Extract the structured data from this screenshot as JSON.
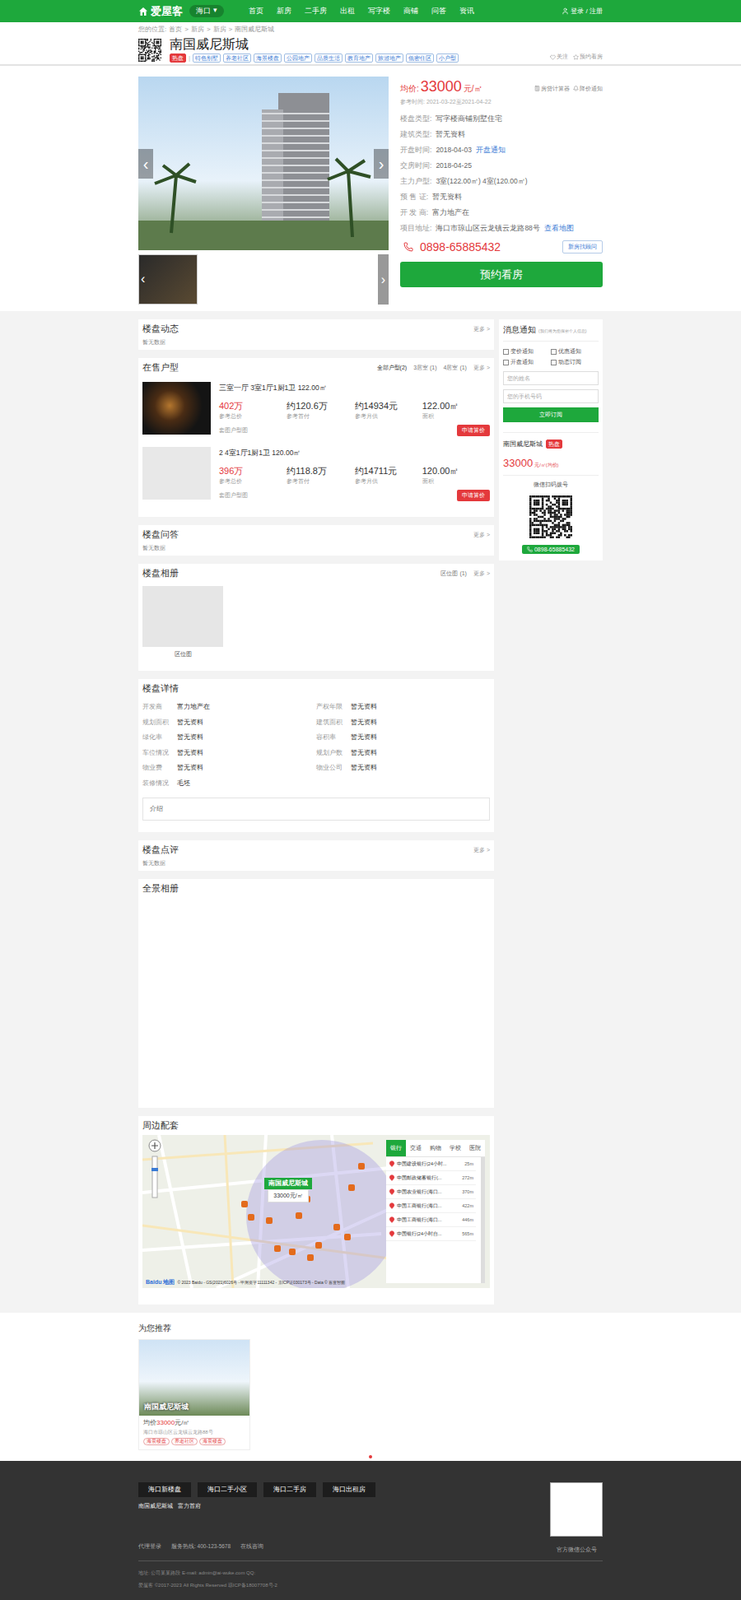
{
  "header": {
    "logo": "爱屋客",
    "city": "海口",
    "city_arrow": "▾",
    "nav": [
      "首页",
      "新房",
      "二手房",
      "出租",
      "写字楼",
      "商铺",
      "问答",
      "资讯"
    ],
    "login": "登录 / 注册"
  },
  "breadcrumb": {
    "label": "您的位置:",
    "separator": ">",
    "items": [
      "首页",
      "新房",
      "新房",
      "南国威尼斯城"
    ]
  },
  "project": {
    "name": "南国威尼斯城",
    "hot": "热盘",
    "divider": "|",
    "tags": [
      "特色别墅",
      "养老社区",
      "海景楼盘",
      "公园地产",
      "品质生活",
      "教育地产",
      "旅游地产",
      "低密住区",
      "小户型"
    ],
    "follow": "关注",
    "book": "预约看房"
  },
  "gallery": {
    "prev": "‹",
    "next": "›",
    "thumb_prev": "‹",
    "thumb_next": "›"
  },
  "info": {
    "price_label": "均价:",
    "price": "33000",
    "price_unit": "元/㎡",
    "calc": "房贷计算器",
    "notify": "降价通知",
    "ref_time_label": "参考时间:",
    "ref_time": "2021-03-22至2021-04-22",
    "rows": [
      {
        "label": "楼盘类型:",
        "value": "写字楼商铺别墅住宅"
      },
      {
        "label": "建筑类型:",
        "value": "暂无资料"
      },
      {
        "label": "开盘时间:",
        "value": "2018-04-03",
        "link": "开盘通知"
      },
      {
        "label": "交房时间:",
        "value": "2018-04-25"
      },
      {
        "label": "主力户型:",
        "value": "3室(122.00㎡) 4室(120.00㎡)"
      },
      {
        "label": "预 售 证:",
        "value": "暂无资料"
      },
      {
        "label": "开 发 商:",
        "value": "富力地产在"
      },
      {
        "label": "项目地址:",
        "value": "海口市琼山区云龙镇云龙路88号",
        "link": "查看地图"
      }
    ],
    "phone": "0898-65885432",
    "consultant": "新房找顾问",
    "cta": "预约看房"
  },
  "more": "更多 >",
  "empty": "暂无数据",
  "dynamics": {
    "title": "楼盘动态"
  },
  "units": {
    "title": "在售户型",
    "tabs": [
      {
        "label": "全部户型(2)",
        "selected": true
      },
      {
        "label": "3居室 (1)",
        "selected": false
      },
      {
        "label": "4居室 (1)",
        "selected": false
      }
    ],
    "stat_labels": [
      "参考总价",
      "参考首付",
      "参考月供",
      "面积"
    ],
    "items": [
      {
        "kind": "photo",
        "title": "三室一厅 3室1厅1厨1卫 122.00㎡",
        "total": "402万",
        "down": "约120.6万",
        "monthly": "约14934元",
        "area": "122.00㎡",
        "note": "套图户型图",
        "button": "申请算价"
      },
      {
        "kind": "placeholder",
        "title": "2 4室1厅1厨1卫 120.00㎡",
        "total": "396万",
        "down": "约118.8万",
        "monthly": "约14711元",
        "area": "120.00㎡",
        "note": "套图户型图",
        "button": "申请算价"
      }
    ]
  },
  "qa": {
    "title": "楼盘问答"
  },
  "album": {
    "title": "楼盘相册",
    "tab": "区位图 (1)",
    "caption": "区位图"
  },
  "details": {
    "title": "楼盘详情",
    "rows": [
      {
        "label": "开发商",
        "value": "富力地产在"
      },
      {
        "label": "产权年限",
        "value": "暂无资料"
      },
      {
        "label": "规划面积",
        "value": "暂无资料"
      },
      {
        "label": "建筑面积",
        "value": "暂无资料"
      },
      {
        "label": "绿化率",
        "value": "暂无资料"
      },
      {
        "label": "容积率",
        "value": "暂无资料"
      },
      {
        "label": "车位情况",
        "value": "暂无资料"
      },
      {
        "label": "规划户数",
        "value": "暂无资料"
      },
      {
        "label": "物业费",
        "value": "暂无资料"
      },
      {
        "label": "物业公司",
        "value": "暂无资料"
      },
      {
        "label": "装修情况",
        "value": "毛坯"
      }
    ],
    "intro": "介绍"
  },
  "review": {
    "title": "楼盘点评"
  },
  "panorama": {
    "title": "全景相册"
  },
  "surroundings": {
    "title": "周边配套",
    "marker_name": "南国威尼斯城",
    "marker_price": "33000元/㎡",
    "copyright": "© 2023 Baidu - GS(2021)6026号 - 甲测资字11111342 - 京ICP证030173号 - Data © 百度智图",
    "baidu": "Baidu 地图",
    "tabs": [
      {
        "label": "银行",
        "selected": true
      },
      {
        "label": "交通",
        "selected": false
      },
      {
        "label": "购物",
        "selected": false
      },
      {
        "label": "学校",
        "selected": false
      },
      {
        "label": "医院",
        "selected": false
      }
    ],
    "places": [
      {
        "name": "中国建设银行(24小时...",
        "distance": "25m"
      },
      {
        "name": "中国邮政储蓄银行(...",
        "distance": "272m"
      },
      {
        "name": "中国农业银行(海口...",
        "distance": "370m"
      },
      {
        "name": "中国工商银行(海口...",
        "distance": "422m"
      },
      {
        "name": "中国工商银行(海口...",
        "distance": "446m"
      },
      {
        "name": "中国银行(24小时自...",
        "distance": "565m"
      }
    ]
  },
  "sidebar": {
    "title": "消息通知",
    "note": "(我们将为您保密个人信息)",
    "options": [
      {
        "label": "变价通知",
        "checked": false
      },
      {
        "label": "优惠通知",
        "checked": false
      },
      {
        "label": "开盘通知",
        "checked": false
      },
      {
        "label": "动态订阅",
        "checked": false
      }
    ],
    "name_placeholder": "您的姓名",
    "phone_placeholder": "您的手机号码",
    "subscribe": "立即订阅",
    "project_name": "南国威尼斯城",
    "hot": "热盘",
    "price": "33000",
    "price_unit": "元/㎡(均价)",
    "scan": "微信扫码拨号",
    "phone": "0898-65885432"
  },
  "recommend": {
    "title": "为您推荐",
    "items": [
      {
        "name": "南国威尼斯城",
        "price_label": "均价",
        "price": "33000",
        "unit": "元/㎡",
        "address": "海口市琼山区云龙镇云龙路88号",
        "tags": [
          "海景楼盘",
          "养老社区",
          "海景楼盘"
        ]
      }
    ]
  },
  "footer": {
    "buttons": [
      "海口新楼盘",
      "海口二手小区",
      "海口二手房",
      "海口出租房"
    ],
    "links": [
      "南国威尼斯城",
      "富力首府"
    ],
    "contact": [
      "代理登录",
      "服务热线: 400-123-5678",
      "在线咨询"
    ],
    "qr_caption": "官方微信公众号",
    "address": "地址: 公司某某路段   E-mail: admin@ai-wuke.com   QQ:",
    "copyright": "爱屋客 ©2017-2023 All Rights Reserved   琼ICP备18007708号-2"
  }
}
